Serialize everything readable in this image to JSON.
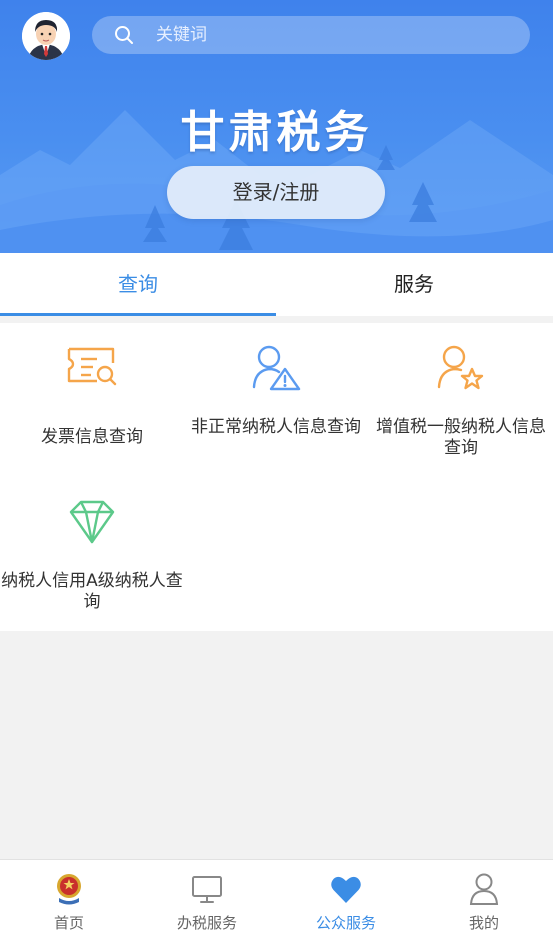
{
  "header": {
    "search_placeholder": "关键词",
    "title": "甘肃税务",
    "login_label": "登录/注册"
  },
  "tabs": [
    {
      "label": "查询",
      "active": true
    },
    {
      "label": "服务",
      "active": false
    }
  ],
  "services": [
    {
      "label": "发票信息查询",
      "icon": "invoice-search-icon",
      "color": "#f5a54a"
    },
    {
      "label": "非正常纳税人信息查询",
      "icon": "user-warning-icon",
      "color": "#5b9bf0"
    },
    {
      "label": "增值税一般纳税人信息查询",
      "icon": "user-star-icon",
      "color": "#f5a54a"
    },
    {
      "label": "纳税人信用A级纳税人查询",
      "icon": "diamond-icon",
      "color": "#5cc98a"
    }
  ],
  "bottom_nav": [
    {
      "label": "首页",
      "icon": "tax-emblem-icon"
    },
    {
      "label": "办税服务",
      "icon": "monitor-icon"
    },
    {
      "label": "公众服务",
      "icon": "heart-icon",
      "active": true
    },
    {
      "label": "我的",
      "icon": "user-icon"
    }
  ],
  "colors": {
    "accent": "#3b8de5",
    "header_blue": "#4a8ff0"
  }
}
